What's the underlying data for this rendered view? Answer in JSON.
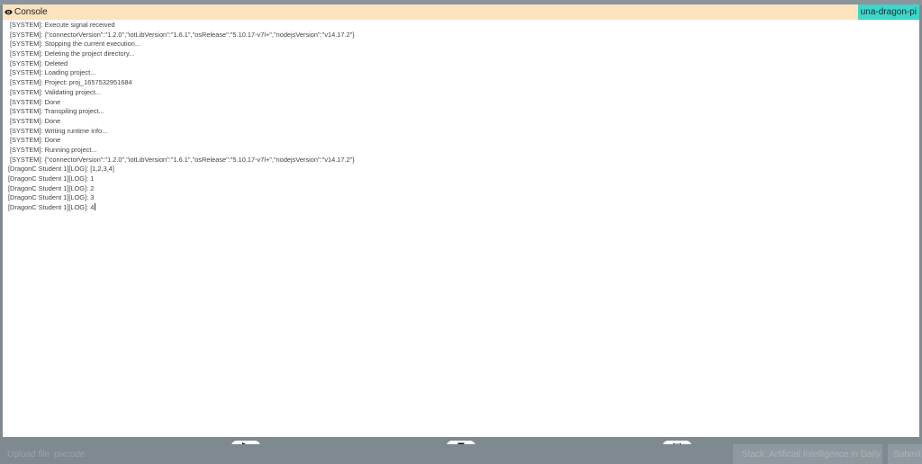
{
  "console": {
    "title": "Console",
    "device": "una-dragon-pi",
    "lines": [
      "[SYSTEM]: Execute signal received",
      "[SYSTEM]: {\"connectorVersion\":\"1.2.0\",\"iotLibVersion\":\"1.6.1\",\"osRelease\":\"5.10.17-v7l+\",\"nodejsVersion\":\"v14.17.2\"}",
      "[SYSTEM]: Stopping the current execution...",
      "[SYSTEM]: Deleting the project directory...",
      "[SYSTEM]: Deleted",
      "[SYSTEM]: Loading project...",
      "[SYSTEM]: Project: proj_1657532951684",
      "[SYSTEM]: Validating project...",
      "[SYSTEM]: Done",
      "[SYSTEM]: Transpiling project...",
      "[SYSTEM]: Done",
      "[SYSTEM]: Writing runtime info...",
      "[SYSTEM]: Done",
      "[SYSTEM]: Running project...",
      "[SYSTEM]: {\"connectorVersion\":\"1.2.0\",\"iotLibVersion\":\"1.6.1\",\"osRelease\":\"5.10.17-v7l+\",\"nodejsVersion\":\"v14.17.2\"}",
      "[DragonC Student 1][LOG]: [1,2,3,4]",
      "[DragonC Student 1][LOG]: 1",
      "[DragonC Student 1][LOG]: 2",
      "[DragonC Student 1][LOG]: 3",
      "[DragonC Student 1][LOG]: 4"
    ]
  },
  "controls": {
    "icons": [
      "play-icon",
      "stop-icon",
      "collapse-icon"
    ]
  },
  "background": {
    "label": "Upload file",
    "file": "pixcode",
    "select": "Stack: Artificial Intelligence in Daily",
    "submit": "Submit"
  },
  "colors": {
    "header": "#fde3bd",
    "badge": "#3dd6c9",
    "overlay": "#7e8a90"
  }
}
